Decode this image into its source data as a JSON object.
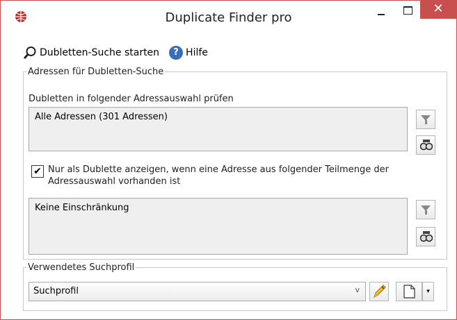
{
  "window": {
    "title": "Duplicate Finder pro",
    "close_glyph": "✕",
    "accent": "#c7504f"
  },
  "toolbar": {
    "start_label": "Dubletten-Suche starten",
    "start_icon": "magnifier-icon",
    "help_label": "Hilfe",
    "help_icon": "help-icon",
    "help_glyph": "?"
  },
  "addresses_group": {
    "legend": "Adressen für Dubletten-Suche",
    "selection_label": "Dubletten in folgender Adressauswahl prüfen",
    "selection_value": "Alle Adressen (301 Adressen)",
    "checkbox_checked": true,
    "checkbox_glyph": "✔",
    "checkbox_label": "Nur als Dublette anzeigen, wenn eine Adresse aus folgender Teilmenge der Adressauswahl vorhanden ist",
    "subset_value": "Keine Einschränkung"
  },
  "profile_group": {
    "legend": "Verwendetes Suchprofil",
    "profile_value": "Suchprofil",
    "dropdown_glyph": "v",
    "split_glyph": "▾"
  }
}
